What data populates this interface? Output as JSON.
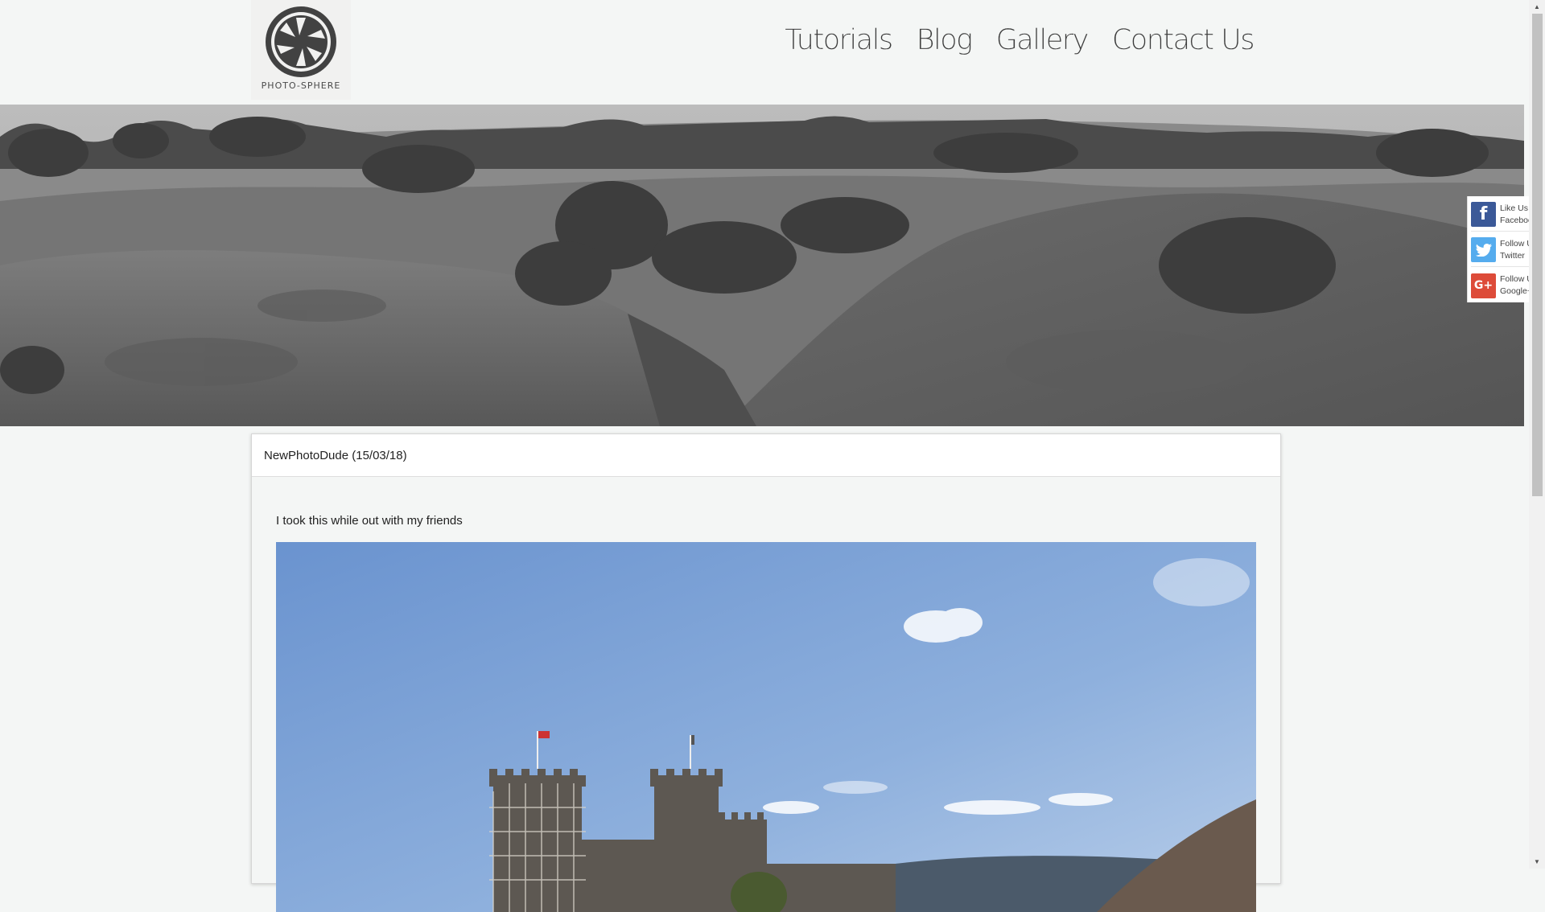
{
  "logo": {
    "text": "PHOTO-SPHERE",
    "icon": "camera-aperture-icon"
  },
  "nav": {
    "items": [
      {
        "label": "Tutorials"
      },
      {
        "label": "Blog"
      },
      {
        "label": "Gallery"
      },
      {
        "label": "Contact Us"
      }
    ]
  },
  "hero": {
    "description_icon": "landscape-banner"
  },
  "social": {
    "items": [
      {
        "line1": "Like Us",
        "line2": "Facebook",
        "icon": "facebook-icon",
        "color": "#3b5998"
      },
      {
        "line1": "Follow Us",
        "line2": "Twitter",
        "icon": "twitter-icon",
        "color": "#55acee"
      },
      {
        "line1": "Follow Us",
        "line2": "Google+",
        "icon": "google-plus-icon",
        "color": "#dd4b39"
      }
    ]
  },
  "post": {
    "header": "NewPhotoDude (15/03/18)",
    "text": "I took this while out with my friends"
  }
}
